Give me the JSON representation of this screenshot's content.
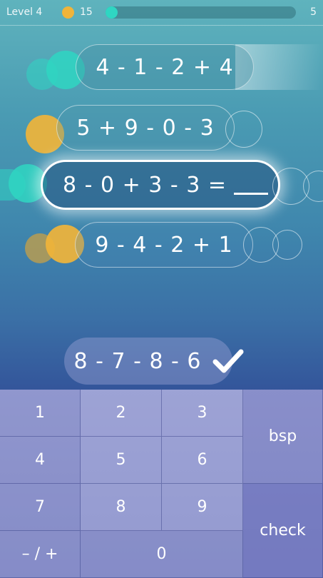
{
  "header": {
    "level_label": "Level 4",
    "coins": "15",
    "progress_count": "5"
  },
  "equations": [
    {
      "text": "4 - 1 - 2 + 4",
      "state": "solved"
    },
    {
      "text": "5 + 9 - 0 - 3",
      "state": "solved"
    },
    {
      "text": "8 - 0 + 3 - 3 =",
      "state": "active"
    },
    {
      "text": "9 - 4 - 2 + 1",
      "state": "upcoming"
    }
  ],
  "answer_bubble": {
    "text": "8 - 7 - 8 - 6",
    "icon": "checkmark-icon"
  },
  "keypad": {
    "keys": [
      "1",
      "2",
      "3",
      "4",
      "5",
      "6",
      "7",
      "8",
      "9",
      "– / +",
      "0"
    ],
    "backspace_label": "bsp",
    "check_label": "check"
  },
  "colors": {
    "teal": "#2fd6c2",
    "gold": "#f0b43a",
    "keypad": "#8e95cc"
  }
}
